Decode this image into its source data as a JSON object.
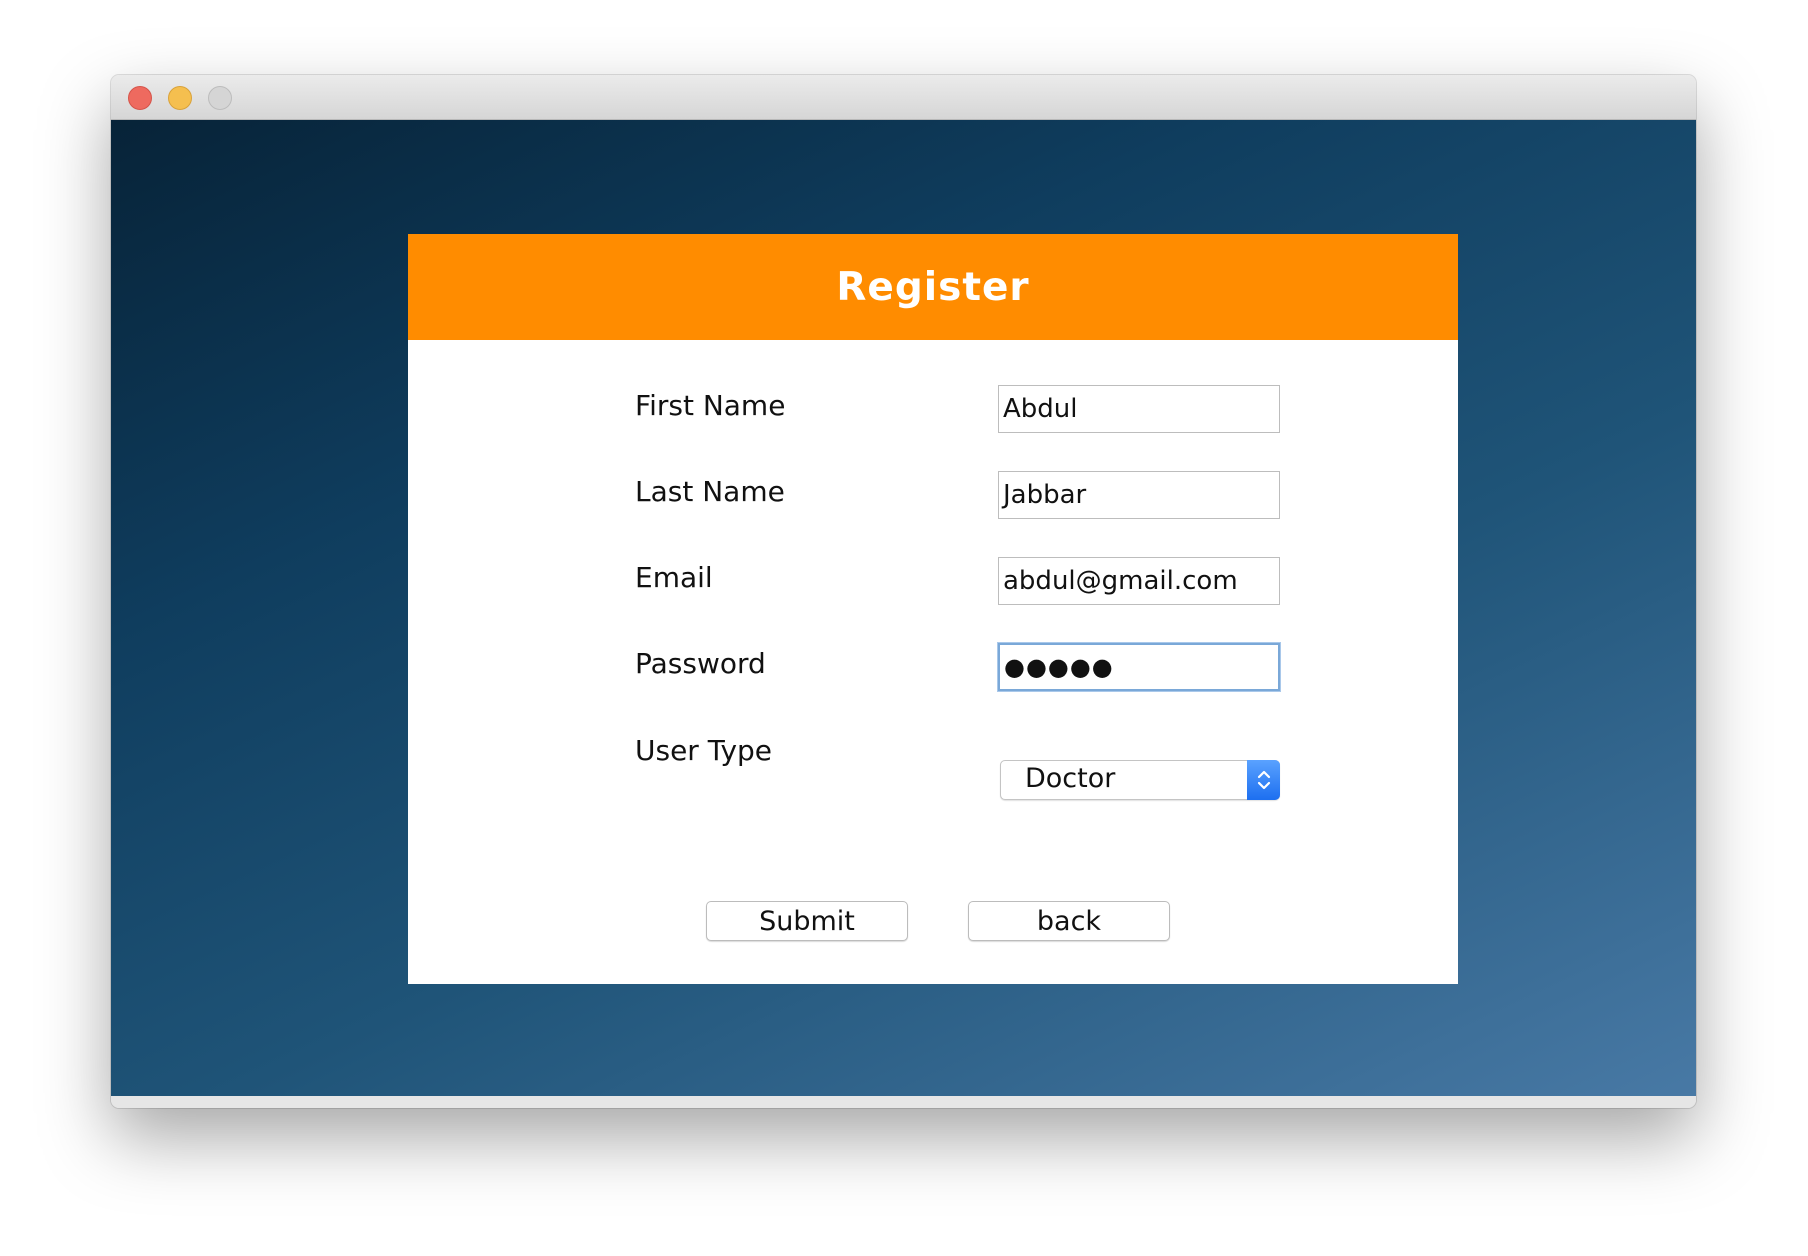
{
  "window": {
    "controls": [
      "close",
      "minimize",
      "zoom"
    ]
  },
  "register": {
    "title": "Register",
    "fields": {
      "first_name": {
        "label": "First Name",
        "value": "Abdul"
      },
      "last_name": {
        "label": "Last Name",
        "value": "Jabbar"
      },
      "email": {
        "label": "Email",
        "value": "abdul@gmail.com"
      },
      "password": {
        "label": "Password",
        "masked_value": "●●●●●"
      },
      "user_type": {
        "label": "User Type",
        "selected": "Doctor"
      }
    },
    "buttons": {
      "submit": "Submit",
      "back": "back"
    }
  },
  "colors": {
    "header": "#ff8c00",
    "background_dark": "#072338",
    "background_light": "#4879a5",
    "select_accent": "#1d6ff0"
  },
  "icons": {
    "select": "chevron-up-down-icon"
  }
}
